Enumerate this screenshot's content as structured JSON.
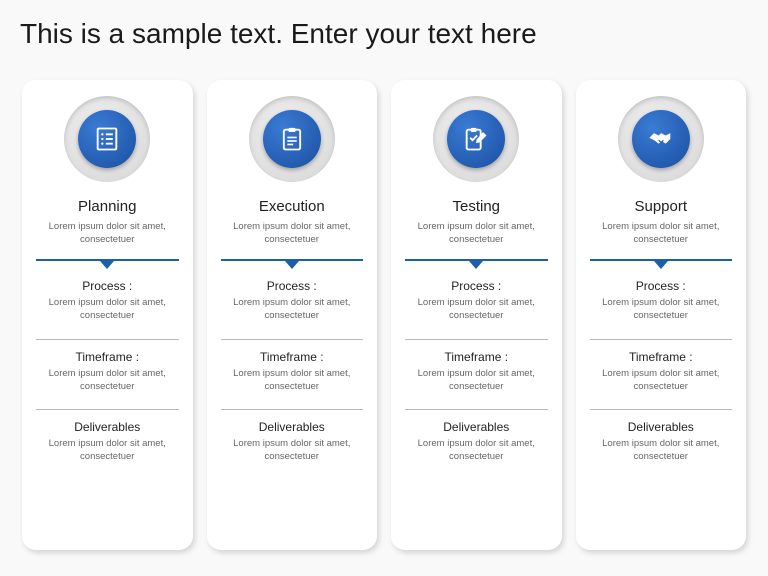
{
  "title": "This is a sample text. Enter your text here",
  "lorem": "Lorem ipsum dolor sit amet, consectetuer",
  "labels": {
    "process": "Process :",
    "timeframe": "Timeframe :",
    "deliverables": "Deliverables"
  },
  "cards": [
    {
      "title": "Planning",
      "icon": "list-icon"
    },
    {
      "title": "Execution",
      "icon": "clipboard-icon"
    },
    {
      "title": "Testing",
      "icon": "clipboard-pen-icon"
    },
    {
      "title": "Support",
      "icon": "handshake-icon"
    }
  ]
}
